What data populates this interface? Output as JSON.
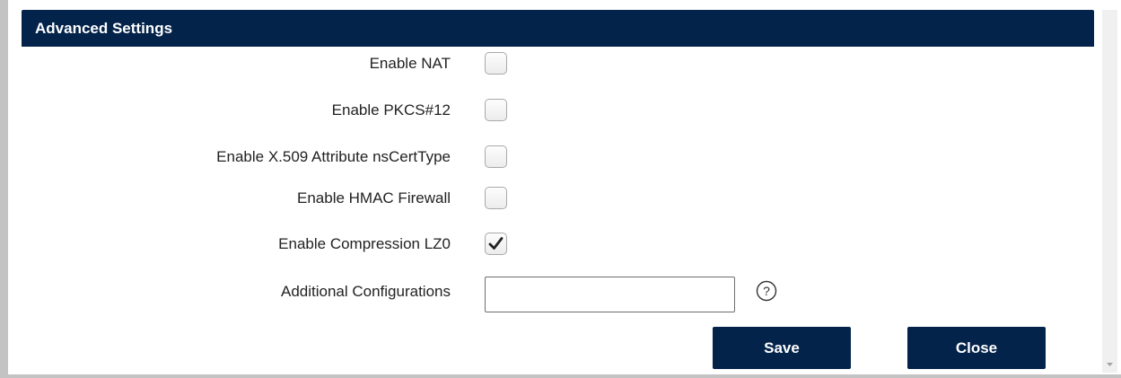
{
  "panel": {
    "title": "Advanced Settings"
  },
  "settings": [
    {
      "label": "Enable NAT",
      "checked": false
    },
    {
      "label": "Enable PKCS#12",
      "checked": false
    },
    {
      "label": "Enable X.509 Attribute nsCertType",
      "checked": false
    },
    {
      "label": "Enable HMAC Firewall",
      "checked": false
    },
    {
      "label": "Enable Compression LZ0",
      "checked": true
    }
  ],
  "additional": {
    "label": "Additional Configurations",
    "value": "",
    "help_icon": "question-circle-icon"
  },
  "buttons": {
    "save_label": "Save",
    "close_label": "Close"
  },
  "colors": {
    "header_bg": "#03234a",
    "button_bg": "#03234a",
    "border_gray": "#c3c3c3"
  }
}
